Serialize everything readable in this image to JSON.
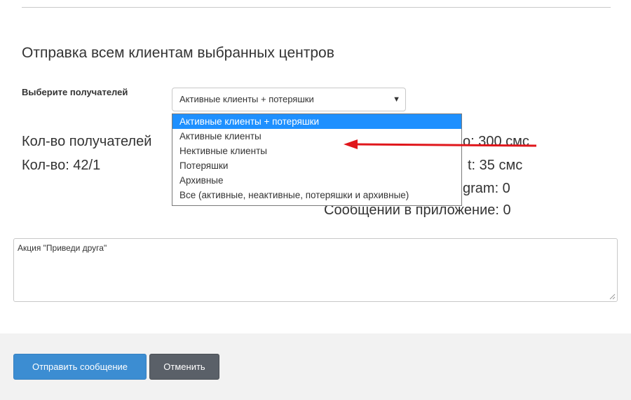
{
  "modal": {
    "title": "Отправка всем клиентам выбранных центров",
    "recipients_label": "Выберите получателей",
    "select": {
      "selected_value": "Активные клиенты + потеряшки",
      "arrow_glyph": "▼",
      "options": [
        "Активные клиенты + потеряшки",
        "Активные клиенты",
        "Нективные клиенты",
        "Потеряшки",
        "Архивные",
        "Все (активные, неактивные, потеряшки и архивные)"
      ]
    },
    "stats": {
      "recipients_count_partial": "Кол-во получателей",
      "count": "Кол-во: 42/1",
      "sms_right_1": "о: 300 смс",
      "sms_right_2": "t: 35 смс",
      "telegram_partial": "gram: 0",
      "app_messages": "Сообщений в приложение: 0"
    },
    "message_text": "Акция \"Приведи друга\"",
    "footer": {
      "send_label": "Отправить сообщение",
      "cancel_label": "Отменить"
    }
  },
  "colors": {
    "primary_button": "#3c8dd2",
    "cancel_button": "#5a6068",
    "selected_option": "#1e90ff",
    "annotation_arrow": "#e0161b"
  }
}
